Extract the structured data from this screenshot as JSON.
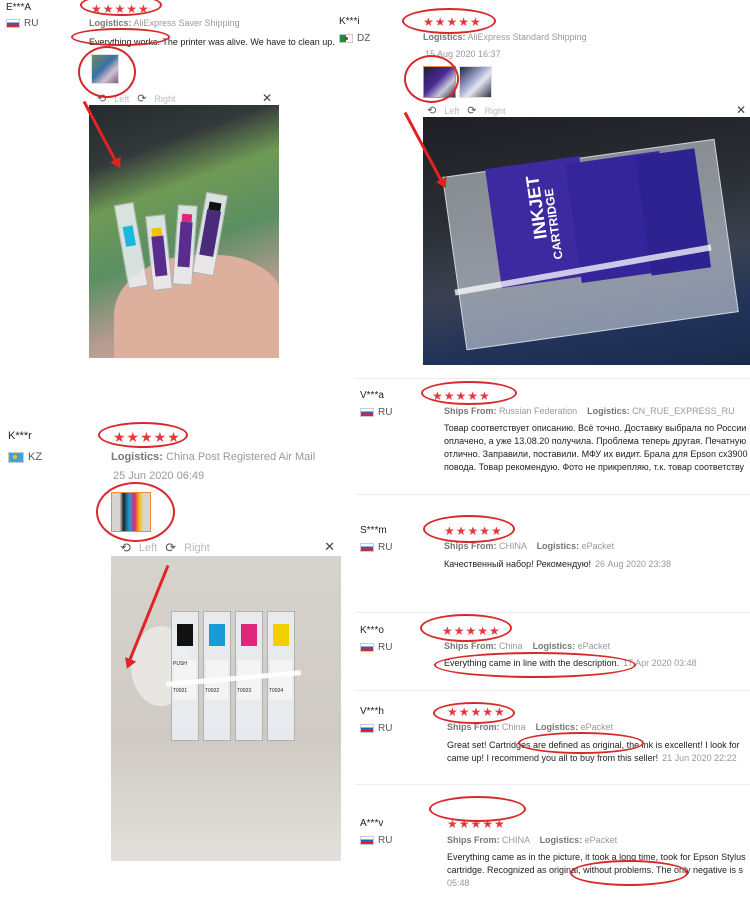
{
  "colors": {
    "star": "#e4393c",
    "annotation": "#d8282b"
  },
  "reviews": [
    {
      "user": "E***A",
      "country": "RU",
      "stars": "★★★★★",
      "logistics_label": "Logistics:",
      "logistics": "AliExpress Saver Shipping",
      "text": "Everything works. The printer was alive. We have to clean up."
    },
    {
      "user": "K***i",
      "country": "DZ",
      "stars": "★★★★★",
      "logistics_label": "Logistics:",
      "logistics": "AliExpress Standard Shipping",
      "date": "15 Aug 2020 16:37"
    },
    {
      "user": "K***r",
      "country": "KZ",
      "stars": "★★★★★",
      "logistics_label": "Logistics:",
      "logistics": "China Post Registered Air Mail",
      "date": "25 Jun 2020 06:49"
    },
    {
      "user": "V***a",
      "country": "RU",
      "stars": "★★★★★",
      "ships_label": "Ships From:",
      "ships_from": "Russian Federation",
      "logistics_label": "Logistics:",
      "logistics": "CN_RUE_EXPRESS_RU",
      "text_lines": [
        "Товар соответствует описанию. Всё точно. Доставку выбрала по России",
        "оплачено, а уже 13.08.20 получила. Проблема теперь другая. Печатную",
        "отлично. Заправили, поставили. МФУ их видит. Брала для Epson cx3900",
        "повода. Товар рекомендую. Фото не прикрепляю, т.к. товар соответству"
      ]
    },
    {
      "user": "S***m",
      "country": "RU",
      "stars": "★★★★★",
      "ships_label": "Ships From:",
      "ships_from": "CHINA",
      "logistics_label": "Logistics:",
      "logistics": "ePacket",
      "text": "Качественный набор! Рекомендую!",
      "date": "26 Aug 2020 23:38"
    },
    {
      "user": "K***o",
      "country": "RU",
      "stars": "★★★★★",
      "ships_label": "Ships From:",
      "ships_from": "China",
      "logistics_label": "Logistics:",
      "logistics": "ePacket",
      "text": "Everything came in line with the description.",
      "date": "17 Apr 2020 03:48"
    },
    {
      "user": "V***h",
      "country": "RU",
      "stars": "★★★★★",
      "ships_label": "Ships From:",
      "ships_from": "China",
      "logistics_label": "Logistics:",
      "logistics": "ePacket",
      "text_lines": [
        "Great set! Cartridges are defined as original, the ink is excellent! I look for",
        "came up! I recommend you all to buy from this seller!"
      ],
      "date": "21 Jun 2020 22:22"
    },
    {
      "user": "A***v",
      "country": "RU",
      "stars": "★★★★★",
      "ships_label": "Ships From:",
      "ships_from": "CHINA",
      "logistics_label": "Logistics:",
      "logistics": "ePacket",
      "text_lines": [
        "Everything came as in the picture, it took a long time, took for Epson Stylus",
        "cartridge. Recognized as original, without problems. The only negative is s",
        "05:48"
      ]
    }
  ],
  "viewer": {
    "left": "Left",
    "right": "Right",
    "close": "✕",
    "rotate_left": "⟲",
    "rotate_right": "⟳"
  },
  "cartridge_labels": {
    "inkjet": "INKJET",
    "cartridge": "CARTRIDGE",
    "push": "PUSH",
    "codes": [
      "T0921",
      "T0922",
      "T0923",
      "T0924"
    ],
    "do_not_remove": "DO NOT REMOVE"
  }
}
